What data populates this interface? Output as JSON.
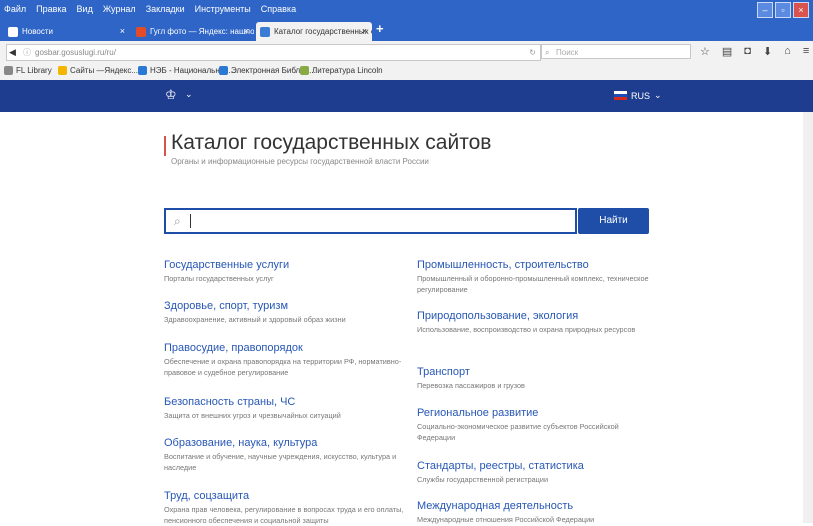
{
  "menubar": {
    "items": [
      "Файл",
      "Правка",
      "Вид",
      "Журнал",
      "Закладки",
      "Инструменты",
      "Справка"
    ]
  },
  "tabs": [
    {
      "label": "Новости",
      "color": "#ffffff"
    },
    {
      "label": "Гугл фото — Яндекс: нашлось...",
      "color": "#e34c26"
    },
    {
      "label": "Каталог государственных с...",
      "color": "#3a7bd5"
    }
  ],
  "nav": {
    "url": "gosbar.gosuslugi.ru/ru/",
    "search_placeholder": "Поиск"
  },
  "bookmarks": [
    {
      "label": "FL Library",
      "color": "#888888"
    },
    {
      "label": "Сайты —Яндекс...",
      "color": "#f2b600"
    },
    {
      "label": "НЭБ - Национальная...",
      "color": "#2a7ad5"
    },
    {
      "label": "Электронная Библио...",
      "color": "#2a7ad5"
    },
    {
      "label": "Литература Lincoln",
      "color": "#88aa44"
    }
  ],
  "site": {
    "lang": "RUS",
    "title": "Каталог государственных сайтов",
    "subtitle": "Органы и информационные ресурсы государственной власти России",
    "search_button": "Найти"
  },
  "categories_left": [
    {
      "title": "Государственные услуги",
      "desc": "Порталы государственных услуг"
    },
    {
      "title": "Здоровье, спорт, туризм",
      "desc": "Здравоохранение, активный и здоровый образ жизни"
    },
    {
      "title": "Правосудие, правопорядок",
      "desc": "Обеспечение и охрана правопорядка на территории РФ, нормативно-правовое и судебное регулирование"
    },
    {
      "title": "Безопасность страны, ЧС",
      "desc": "Защита от внешних угроз и чрезвычайных ситуаций"
    },
    {
      "title": "Образование, наука, культура",
      "desc": "Воспитание и обучение, научные учреждения, искусство, культура и наследие"
    },
    {
      "title": "Труд, соцзащита",
      "desc": "Охрана прав человека, регулирование в вопросах труда и его оплаты, пенсионного обеспечения и социальной защиты"
    }
  ],
  "categories_right": [
    {
      "title": "Промышленность, строительство",
      "desc": "Промышленный и оборонно-промышленный комплекс, техническое регулирование"
    },
    {
      "title": "Природопользование, экология",
      "desc": "Использование, воспроизводство и охрана природных ресурсов"
    },
    {
      "title": "Транспорт",
      "desc": "Перевозка пассажиров и грузов"
    },
    {
      "title": "Региональное развитие",
      "desc": "Социально-экономическое развитие субъектов Российской Федерации"
    },
    {
      "title": "Стандарты, реестры, статистика",
      "desc": "Службы государственной регистрации"
    },
    {
      "title": "Международная деятельность",
      "desc": "Международные отношения Российской Федерации"
    }
  ]
}
